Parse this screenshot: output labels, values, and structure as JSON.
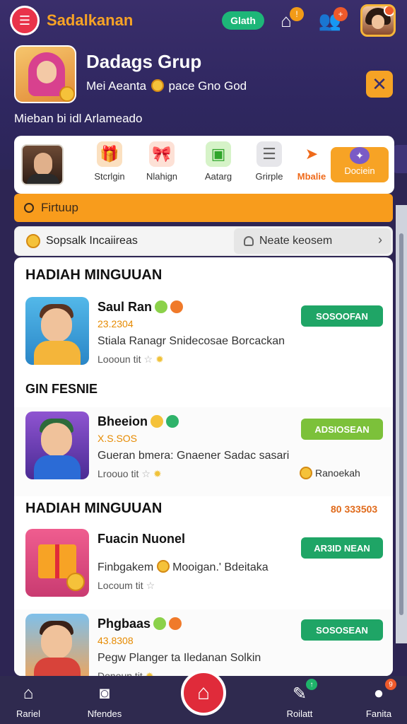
{
  "header": {
    "brand": "Sadalkanan",
    "status_pill": "Glath",
    "notif_badge": "!",
    "friends_badge": "+"
  },
  "group": {
    "title": "Dadags Grup",
    "subtitle_left": "Mei Aeanta",
    "subtitle_right": "pace Gno God",
    "caption": "Mieban bi idl Arlameado",
    "close": "✕"
  },
  "categories": [
    {
      "label": "Stcrlgin",
      "icon": "gift-box-icon"
    },
    {
      "label": "Nlahign",
      "icon": "present-icon"
    },
    {
      "label": "Aatarg",
      "icon": "green-box-icon"
    },
    {
      "label": "Grirple",
      "icon": "bottle-icon"
    },
    {
      "label": "Mbalie",
      "icon": "arrow-icon"
    },
    {
      "label": "Dociein",
      "icon": "badge-icon"
    }
  ],
  "search": {
    "label": "Firtuup"
  },
  "filter": {
    "left": "Sopsalk Incaiireas",
    "right": "Neate keosem",
    "chevron": "›"
  },
  "sections": [
    {
      "title": "HADIAH MINGUUAN"
    },
    {
      "title": "GIN FESNIE"
    },
    {
      "title": "HADIAH MINGUUAN",
      "meta": "80 333503"
    }
  ],
  "items": [
    {
      "title": "Saul Ran",
      "price": "23.2304",
      "desc": "Stiala Ranagr Snidecosae Borcackan",
      "meta": "Loooun tit",
      "cta": "SOSOOFAN"
    },
    {
      "title": "Bheeion",
      "price": "X.S.SOS",
      "desc": "Gueran bmera: Gnaener Sadac sasari",
      "meta": "Lroouo tit",
      "cta": "ADSIOSEAN",
      "note": "Ranoekah"
    },
    {
      "title": "Fuacin Nuonel",
      "price": "",
      "desc": "Finbgakem",
      "desc2": "Mooigan.' Bdeitaka",
      "meta": "Locoum tit",
      "cta": "AR3ID NEAN"
    },
    {
      "title": "Phgbaas",
      "price": "43.8308",
      "desc": "Pegw Planger ta Iledanan Solkin",
      "meta": "Donoun tit",
      "cta": "SOSOSEAN"
    }
  ],
  "bottom_nav": [
    {
      "label": "Rariel",
      "icon": "home-icon"
    },
    {
      "label": "Nfendes",
      "icon": "camera-icon"
    },
    {
      "label": "",
      "icon": "house-fab-icon"
    },
    {
      "label": "Roilatt",
      "icon": "edit-icon"
    },
    {
      "label": "Fanita",
      "icon": "person-icon"
    }
  ]
}
